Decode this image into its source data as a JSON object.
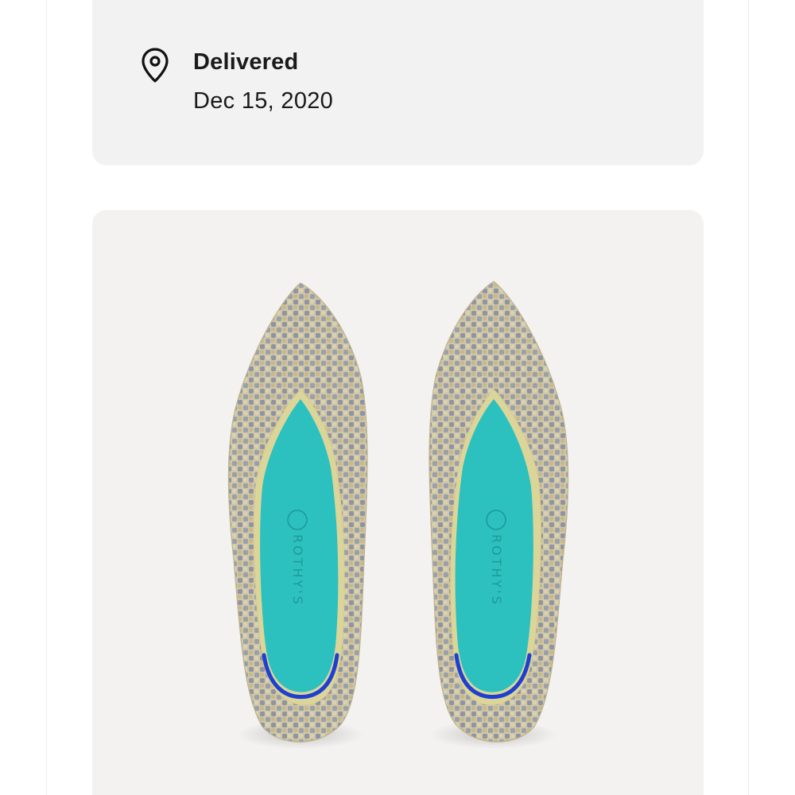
{
  "delivery": {
    "status": "Delivered",
    "date": "Dec 15, 2020",
    "icon": "location-pin-icon"
  },
  "product": {
    "image_label": "ROTHY'S",
    "colors": {
      "insole": "#2cc1bf",
      "heel_accent": "#1f3fd0",
      "knit": "#c9c2a8"
    }
  }
}
